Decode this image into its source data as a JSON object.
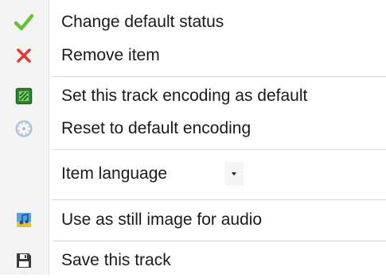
{
  "menu": {
    "items": [
      {
        "label": "Change default status",
        "icon": "checkmark-icon"
      },
      {
        "label": "Remove item",
        "icon": "remove-x-icon"
      },
      {
        "label": "Set this track encoding as default",
        "icon": "encoding-icon"
      },
      {
        "label": "Reset to default encoding",
        "icon": "gear-icon"
      },
      {
        "label": "Use as still image for audio",
        "icon": "music-image-icon"
      },
      {
        "label": "Save this track",
        "icon": "floppy-disk-icon"
      }
    ],
    "language": {
      "label": "Item language",
      "icon": "dropdown-arrow-icon"
    }
  },
  "colors": {
    "check": "#6dbf3a",
    "remove": "#e03a2a",
    "encoding": "#2f8a2f",
    "gear": "#aebfd0",
    "save": "#3a3a3a"
  }
}
